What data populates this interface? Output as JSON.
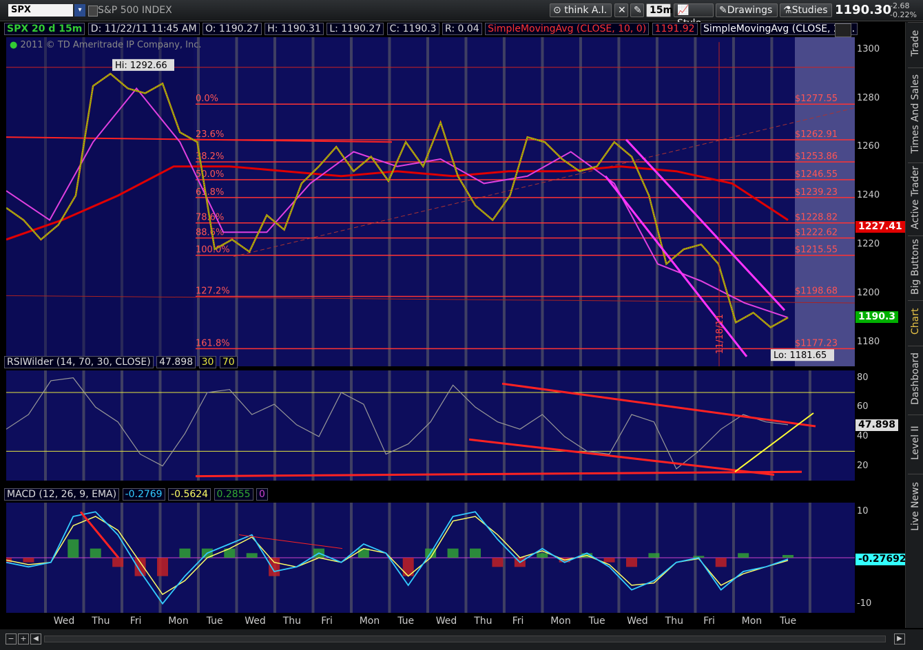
{
  "toolbar": {
    "symbol": "SPX",
    "symbol_name": "S&P 500 INDEX",
    "think_label": "think A.I.",
    "period_label": "15m",
    "style_label": "Style",
    "drawings_label": "Drawings",
    "studies_label": "Studies",
    "last_price": "1190.30",
    "net_change": "-2.68",
    "pct_change": "-0.22%"
  },
  "sidebar": {
    "tabs": [
      "Trade",
      "Times And Sales",
      "Active Trader",
      "Big Buttons",
      "Chart",
      "Dashboard",
      "Level II",
      "Live News"
    ],
    "active": "Chart"
  },
  "price_header": {
    "aggregation": "SPX 20 d 15m",
    "date": "D: 11/22/11 11:45 AM",
    "open": "O: 1190.27",
    "high": "H: 1190.31",
    "low": "L: 1190.27",
    "close": "C: 1190.3",
    "range": "R: 0.04",
    "sma1_label": "SimpleMovingAvg (CLOSE, 10, 0)",
    "sma1_value": "1191.92",
    "sma2_label": "SimpleMovingAvg (CLOSE, 20...",
    "copyright": "2011 © TD Ameritrade IP Company, Inc."
  },
  "colors": {
    "pane_bg": "#0d0d5c",
    "price_line": "#e0c000",
    "sma_red": "#e00000",
    "sma_magenta": "#e040e0",
    "sma_white": "#e8e8e8",
    "fib_red": "#ff3333",
    "rsi_gray": "#999999",
    "macd_cyan": "#33ccff",
    "macd_yellow": "#ffff66"
  },
  "annotations": {
    "hi_label": "Hi: 1292.66",
    "lo_label": "Lo: 1181.65",
    "vertical_date_label": "11/18/11"
  },
  "chart_data": [
    {
      "type": "line",
      "name": "price",
      "ylim": [
        1170,
        1305
      ],
      "y_ticks": [
        1180,
        1200,
        1220,
        1240,
        1260,
        1280,
        1300
      ],
      "x_day_labels": [
        "Wed",
        "Thu",
        "Fri",
        "Mon",
        "Tue",
        "Wed",
        "Thu",
        "Fri",
        "Mon",
        "Tue",
        "Wed",
        "Thu",
        "Fri",
        "Mon",
        "Tue",
        "Wed",
        "Thu",
        "Fri",
        "Mon",
        "Tue"
      ],
      "fib_levels": [
        {
          "pct": "0.0%",
          "price": "1277.55"
        },
        {
          "pct": "23.6%",
          "price": "1262.91"
        },
        {
          "pct": "38.2%",
          "price": "1253.86"
        },
        {
          "pct": "50.0%",
          "price": "1246.55"
        },
        {
          "pct": "61.8%",
          "price": "1239.23"
        },
        {
          "pct": "78.6%",
          "price": "1228.82"
        },
        {
          "pct": "88.6%",
          "price": "1222.62"
        },
        {
          "pct": "100.0%",
          "price": "1215.55"
        },
        {
          "pct": "127.2%",
          "price": "1198.68"
        },
        {
          "pct": "161.8%",
          "price": "1177.23"
        }
      ],
      "right_tags": [
        {
          "value": "1227.41",
          "color": "#e00000",
          "text": "#ffffff"
        },
        {
          "value": "1190.3",
          "color": "#00b000",
          "text": "#ffffff"
        }
      ],
      "close_series": [
        1235,
        1230,
        1222,
        1228,
        1240,
        1285,
        1290,
        1284,
        1282,
        1286,
        1266,
        1262,
        1218,
        1222,
        1217,
        1232,
        1226,
        1245,
        1252,
        1260,
        1250,
        1256,
        1246,
        1262,
        1252,
        1270,
        1248,
        1236,
        1230,
        1240,
        1264,
        1262,
        1255,
        1250,
        1252,
        1262,
        1256,
        1240,
        1212,
        1218,
        1220,
        1212,
        1188,
        1192,
        1186,
        1190
      ],
      "sma_red_series": [
        1222,
        1230,
        1240,
        1252,
        1252,
        1250,
        1248,
        1250,
        1248,
        1250,
        1250,
        1252,
        1250,
        1245,
        1230
      ],
      "sma_magenta_series": [
        1242,
        1230,
        1262,
        1284,
        1262,
        1225,
        1225,
        1245,
        1258,
        1252,
        1255,
        1245,
        1248,
        1258,
        1245,
        1212,
        1205,
        1196,
        1190
      ]
    },
    {
      "type": "line",
      "name": "RSIWilder (14, 70, 30, CLOSE)",
      "value": "47.898",
      "levels": [
        "30",
        "70"
      ],
      "ylim": [
        10,
        85
      ],
      "y_ticks": [
        20,
        40,
        60,
        80
      ],
      "series": [
        45,
        55,
        78,
        80,
        60,
        50,
        28,
        20,
        42,
        70,
        72,
        55,
        62,
        48,
        40,
        70,
        62,
        28,
        35,
        50,
        75,
        60,
        50,
        45,
        55,
        40,
        30,
        28,
        55,
        50,
        18,
        30,
        45,
        55,
        50,
        48
      ]
    },
    {
      "type": "bar",
      "name": "MACD (12, 26, 9, EMA)",
      "values_text": [
        "-0.2769",
        "-0.5624",
        "0.2855",
        "0"
      ],
      "ylim": [
        -12,
        12
      ],
      "y_ticks": [
        -10,
        10
      ],
      "right_tag": "-0.27692",
      "macd_series": [
        -1,
        -2,
        -1,
        9,
        10,
        5,
        -3,
        -10,
        -4,
        1,
        3,
        5,
        -3,
        -2,
        1,
        -1,
        3,
        1,
        -6,
        1,
        9,
        10,
        4,
        -1,
        2,
        -1,
        1,
        -2,
        -7,
        -5,
        -1,
        0,
        -7,
        -3,
        -2,
        -0.3
      ],
      "signal_series": [
        -0.5,
        -1.5,
        -1,
        7,
        9,
        6,
        -1,
        -8,
        -5,
        0,
        2,
        4.5,
        -1,
        -2,
        0,
        -1,
        2,
        1,
        -4,
        0,
        8,
        9,
        5,
        0,
        1.5,
        -0.5,
        0.5,
        -1.5,
        -6,
        -5.5,
        -1,
        -0.2,
        -6,
        -3.5,
        -2,
        -0.6
      ]
    }
  ]
}
